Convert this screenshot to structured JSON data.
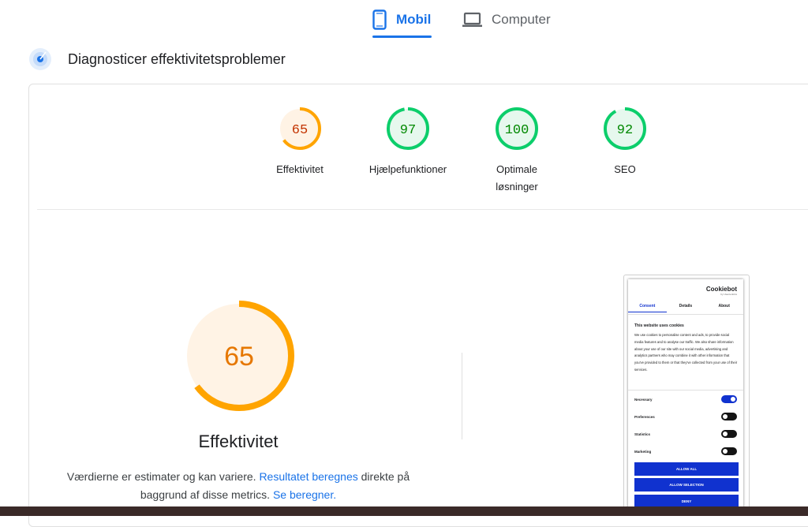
{
  "tabs": {
    "mobile_label": "Mobil",
    "desktop_label": "Computer",
    "active": "mobile"
  },
  "diagnostics": {
    "title": "Diagnosticer effektivitetsproblemer",
    "icon": "diagnose-icon"
  },
  "scores": [
    {
      "value": "65",
      "score": 65,
      "label_line1": "Effektivitet",
      "label_line2": "",
      "color": "#ffa400",
      "text_color": "#c33300",
      "bg": "#fff3e5"
    },
    {
      "value": "97",
      "score": 97,
      "label_line1": "Hjælpefunktioner",
      "label_line2": "",
      "color": "#0cce6b",
      "text_color": "#008800",
      "bg": "#e6f8ee"
    },
    {
      "value": "100",
      "score": 100,
      "label_line1": "Optimale",
      "label_line2": "løsninger",
      "color": "#0cce6b",
      "text_color": "#008800",
      "bg": "#e6f8ee"
    },
    {
      "value": "92",
      "score": 92,
      "label_line1": "SEO",
      "label_line2": "",
      "color": "#0cce6b",
      "text_color": "#008800",
      "bg": "#e6f8ee"
    }
  ],
  "main_gauge": {
    "value": "65",
    "score": 65,
    "title": "Effektivitet",
    "color": "#ffa400",
    "text_color": "#e67700",
    "bg": "#fff3e5"
  },
  "description": {
    "text1": "Værdierne er estimater og kan variere. ",
    "link1": "Resultatet beregnes",
    "text2": " direkte på baggrund af disse metrics.",
    "link2": "Se beregner."
  },
  "screenshot": {
    "logo": "Cookiebot",
    "logo_sub": "by Usercentrics",
    "tabs": [
      "Consent",
      "Details",
      "About"
    ],
    "heading": "This website uses cookies",
    "body": "We use cookies to personalise content and ads, to provide social media features and to analyse our traffic. We also share information about your use of our site with our social media, advertising and analytics partners who may combine it with other information that you've provided to them or that they've collected from your use of their services.",
    "toggles": [
      {
        "label": "Necessary",
        "state": "on"
      },
      {
        "label": "Preferences",
        "state": "off"
      },
      {
        "label": "Statistics",
        "state": "off"
      },
      {
        "label": "Marketing",
        "state": "off"
      }
    ],
    "buttons": [
      "ALLOW ALL",
      "ALLOW SELECTION",
      "DENY"
    ]
  }
}
